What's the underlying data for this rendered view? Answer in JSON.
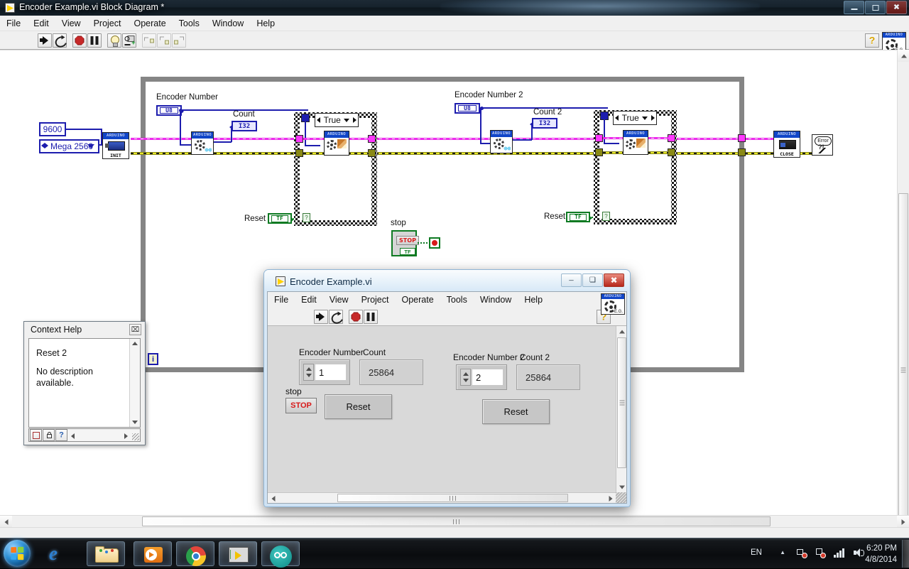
{
  "block_diagram_window": {
    "title": "Encoder Example.vi Block Diagram *",
    "icon_name": "labview-vi-icon",
    "menu": [
      "File",
      "Edit",
      "View",
      "Project",
      "Operate",
      "Tools",
      "Window",
      "Help"
    ],
    "window_buttons": {
      "minimize": "–",
      "restore": "❑",
      "close": "✕"
    },
    "toolbar": {
      "run": "run-arrow-icon",
      "run_continuously": "run-continuously-icon",
      "abort": "abort-execution-icon",
      "pause": "pause-icon",
      "highlight_execution": "light-bulb-icon",
      "retain_wire_values": "probe-values-icon",
      "step_into": "step-into-icon",
      "step_over": "step-over-icon",
      "step_out": "step-out-icon",
      "context_help": "?",
      "vi_icon_caption": "ARDUINO",
      "vi_icon_eg": "E.G."
    },
    "diagram": {
      "baud_constant": "9600",
      "board_ring": "Mega 2560",
      "init_label": "INIT",
      "close_label": "CLOSE",
      "arduino_caption": "ARDUINO",
      "encoder1_label": "Encoder Number",
      "encoder1_type": "U8",
      "count1_label": "Count",
      "count1_type": "I32",
      "reset1_label": "Reset",
      "reset1_type": "TF",
      "case1_selector": "True",
      "encoder2_label": "Encoder Number 2",
      "encoder2_type": "U8",
      "count2_label": "Count 2",
      "count2_type": "I32",
      "reset2_label": "Reset",
      "reset2_type": "TF",
      "case2_selector": "True",
      "stop_label": "stop",
      "stop_button_text": "STOP",
      "stop_tf": "TF",
      "error_node": "Error",
      "error_mark": "?!",
      "iteration_terminal": "i",
      "case_q_mark": "?",
      "wire_colors": {
        "error_cluster": "#8a8a16",
        "arduino_refnum": "#ff3dff",
        "numeric": "#1d1dae",
        "boolean": "#0e7a22"
      }
    }
  },
  "context_help": {
    "title": "Context Help",
    "close_glyph": "⌧",
    "heading": "Reset 2",
    "description": "No description available.",
    "buttons": [
      "show-hide-optional-terminals-icon",
      "lock-context-help-icon",
      "detailed-help-icon"
    ]
  },
  "front_panel_window": {
    "title": "Encoder Example.vi",
    "icon_name": "labview-vi-icon",
    "menu": [
      "File",
      "Edit",
      "View",
      "Project",
      "Operate",
      "Tools",
      "Window",
      "Help"
    ],
    "window_buttons": {
      "minimize": "–",
      "restore": "❑",
      "close": "✕"
    },
    "toolbar": {
      "run": "run-arrow-icon",
      "run_continuously": "run-continuously-icon",
      "abort": "abort-execution-icon",
      "pause": "pause-icon",
      "context_help": "?",
      "vi_icon_caption": "ARDUINO",
      "vi_icon_eg": "E.G."
    },
    "controls": {
      "encoder1_label": "Encoder Number",
      "encoder1_value": "1",
      "count1_label": "Count",
      "count1_value": "25864",
      "stop_label": "stop",
      "stop_button": "STOP",
      "reset1_button": "Reset",
      "encoder2_label": "Encoder Number 2",
      "encoder2_value": "2",
      "count2_label": "Count 2",
      "count2_value": "25864",
      "reset2_button": "Reset"
    }
  },
  "taskbar": {
    "start_button": "start-orb-icon",
    "items": [
      {
        "name": "internet-explorer",
        "label": "e"
      },
      {
        "name": "windows-explorer",
        "label": ""
      },
      {
        "name": "windows-media-player",
        "label": ""
      },
      {
        "name": "google-chrome",
        "label": ""
      },
      {
        "name": "labview",
        "label": ""
      },
      {
        "name": "arduino-ide",
        "label": ""
      }
    ],
    "tray": {
      "language": "EN",
      "show_hidden_glyph": "▲",
      "network_icon": "network-icon",
      "action_center_icon": "action-center-icon",
      "signal_icon": "signal-bars-icon",
      "volume_icon": "volume-icon",
      "time": "6:20 PM",
      "date": "4/8/2014"
    }
  }
}
